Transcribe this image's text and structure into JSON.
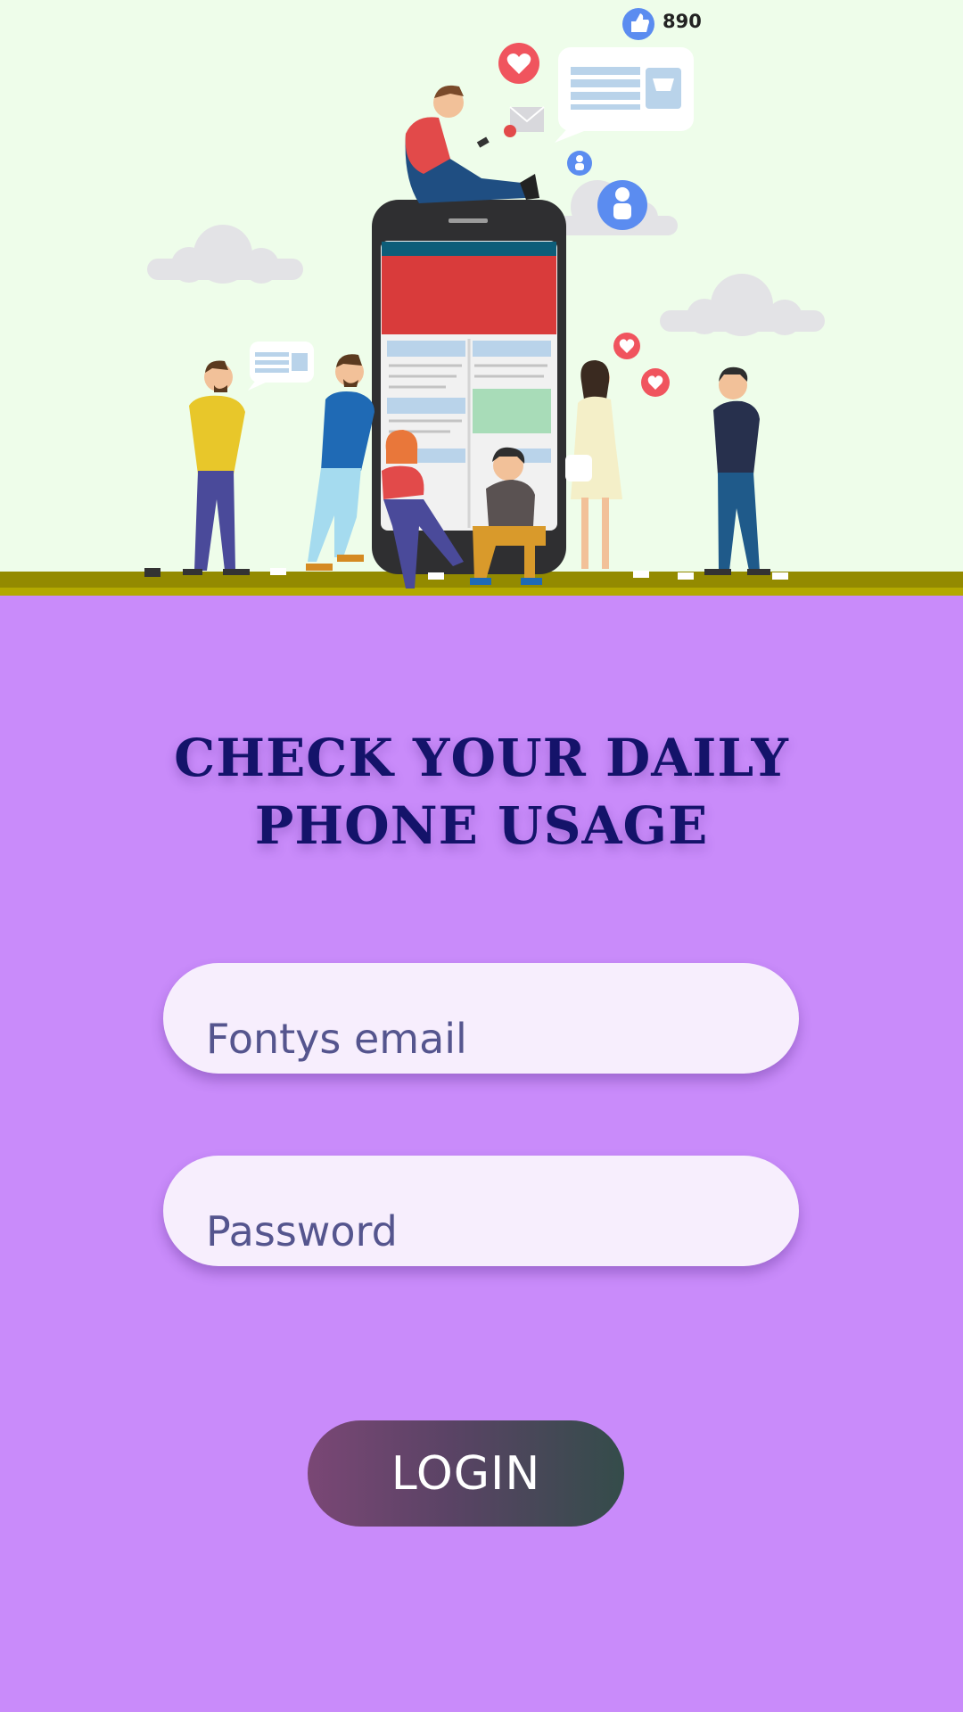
{
  "hero": {
    "like_count": "890",
    "colors": {
      "background": "#eefdea",
      "ground": "#938a00",
      "heart": "#f0545e",
      "like": "#5b8cf0"
    }
  },
  "title": {
    "line1": "CHECK YOUR DAILY",
    "line2": "PHONE USAGE"
  },
  "form": {
    "email_placeholder": "Fontys email",
    "password_placeholder": "Password",
    "login_label": "LOGIN"
  },
  "colors": {
    "page_background": "#c98bfa",
    "title": "#14136a",
    "field_background": "#f7eefd",
    "button_start": "#7a4775",
    "button_end": "#344c4a"
  }
}
